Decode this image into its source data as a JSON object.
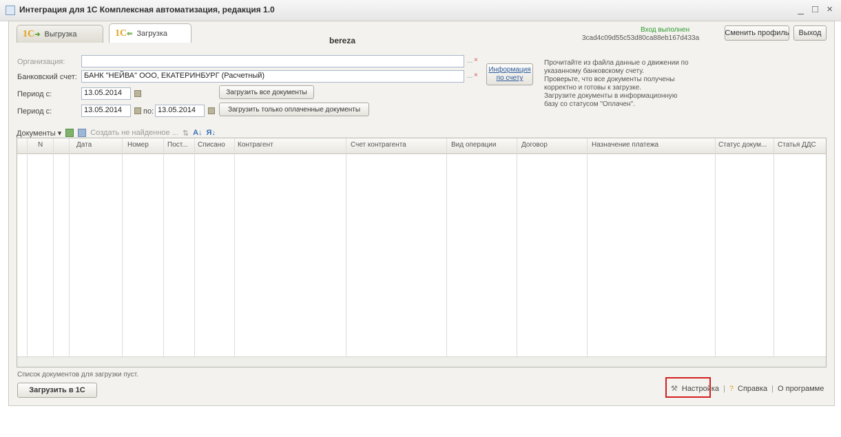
{
  "window": {
    "title": "Интеграция для 1С Комплексная автоматизация, редакция 1.0",
    "controls": "_ □ ×"
  },
  "tabs": [
    {
      "logo": "1С",
      "label": "Выгрузка"
    },
    {
      "logo": "1С",
      "label": "Загрузка"
    }
  ],
  "header": {
    "center_title": "bereza",
    "status": "Вход выполнен",
    "session_id": "3cad4c09d55c53d80ca88eb167d433a",
    "change_profile_label": "Сменить профиль",
    "exit_label": "Выход"
  },
  "form": {
    "org_label": "Организация:",
    "org_value": "",
    "bank_label": "Банковский счет:",
    "bank_value": "БАНК \"НЕЙВА\" ООО, ЕКАТЕРИНБУРГ (Расчетный)",
    "period1_label": "Период с:",
    "period1_from": "13.05.2014",
    "period2_label": "Период с:",
    "period2_from": "13.05.2014",
    "period2_to_label": "по:",
    "period2_to": "13.05.2014",
    "info_button": "Информация по счету",
    "load_all_label": "Загрузить все документы",
    "load_paid_label": "Загрузить только оплаченные документы",
    "clear_btn": "...",
    "remove_btn": "×"
  },
  "info_text": [
    "Прочитайте из файла данные о движении по",
    "указанному банковскому счету.",
    "Проверьте, что все документы получены",
    "корректно и готовы к загрузке.",
    "Загрузите документы в информационную",
    "базу со статусом \"Оплачен\"."
  ],
  "toolbar": {
    "documents_label": "Документы ▾",
    "create_missing_label": "Создать не найденное ..."
  },
  "table": {
    "columns": [
      "N",
      "Дата",
      "Номер",
      "Пост...",
      "Списано",
      "Контрагент",
      "Счет контрагента",
      "Вид операции",
      "Договор",
      "Назначение платежа",
      "Статус докум...",
      "Статья ДДС"
    ],
    "rows": []
  },
  "footer": {
    "empty_message": "Список документов для загрузки пуст.",
    "load_button": "Загрузить в 1С",
    "settings_label": "Настройка",
    "help_label": "Справка",
    "about_label": "О программе"
  },
  "colors": {
    "highlight": "#d21f1f",
    "status_ok": "#2f9a2f",
    "logo": "#e3a31a"
  }
}
